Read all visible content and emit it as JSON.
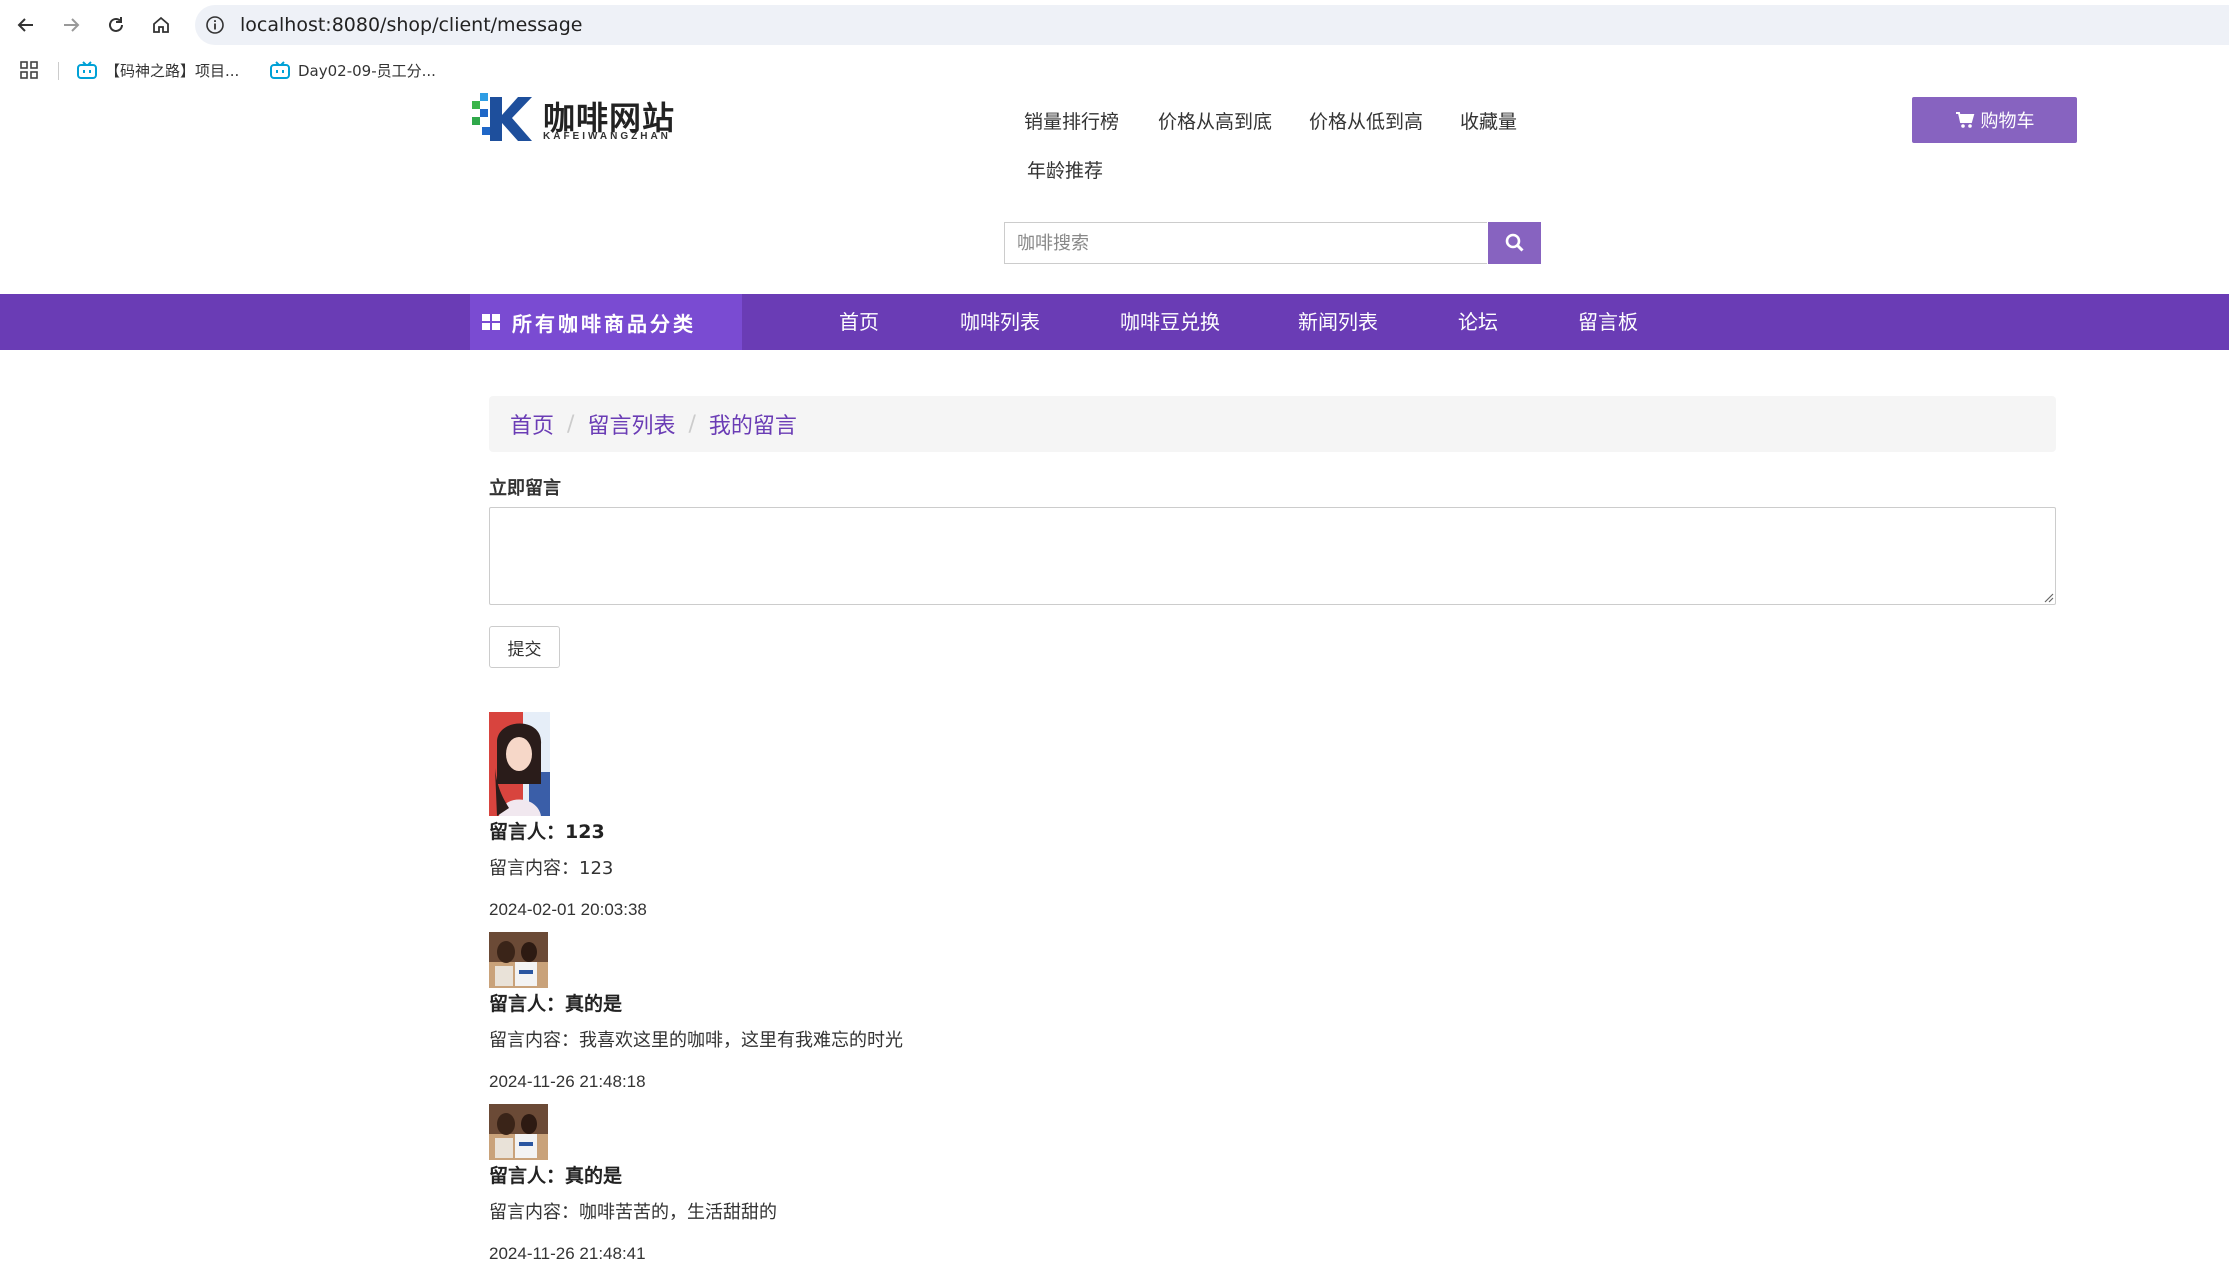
{
  "browser": {
    "url": "localhost:8080/shop/client/message",
    "bookmarks": [
      {
        "label": "【码神之路】项目..."
      },
      {
        "label": "Day02-09-员工分..."
      }
    ]
  },
  "header": {
    "logo_cn": "咖啡网站",
    "logo_en": "KAFEIWANGZHAN",
    "top_links": [
      "销量排行榜",
      "价格从高到底",
      "价格从低到高",
      "收藏量",
      "年龄推荐"
    ],
    "cart_label": "购物车",
    "search_placeholder": "咖啡搜索"
  },
  "nav": {
    "category_label": "所有咖啡商品分类",
    "links": [
      "首页",
      "咖啡列表",
      "咖啡豆兑换",
      "新闻列表",
      "论坛",
      "留言板"
    ]
  },
  "breadcrumb": [
    "首页",
    "留言列表",
    "我的留言"
  ],
  "form": {
    "label": "立即留言",
    "textarea_value": "",
    "submit_label": "提交"
  },
  "messages": [
    {
      "author": "留言人：123",
      "content": "留言内容：123",
      "time": "2024-02-01 20:03:38"
    },
    {
      "author": "留言人：真的是",
      "content": "留言内容：我喜欢这里的咖啡，这里有我难忘的时光",
      "time": "2024-11-26 21:48:18"
    },
    {
      "author": "留言人：真的是",
      "content": "留言内容：咖啡苦苦的，生活甜甜的",
      "time": "2024-11-26 21:48:41"
    }
  ],
  "colors": {
    "accent": "#6a3cb5",
    "button": "#8763c0",
    "category": "#7a4bd2",
    "link": "#6a3cb5"
  }
}
